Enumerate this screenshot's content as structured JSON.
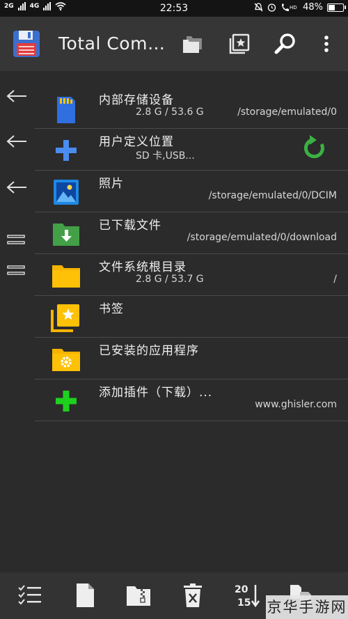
{
  "status_bar": {
    "time": "22:53",
    "left_labels": [
      "2G",
      "4G"
    ],
    "hd_label": "HD",
    "battery": "48%",
    "battery_level": 0.48
  },
  "app_bar": {
    "title": "Total Com…",
    "actions": [
      "folders-icon",
      "bookmark-star-icon",
      "search-icon",
      "more-vertical-icon"
    ]
  },
  "side_rail": {
    "buttons": [
      "arrow-left-icon",
      "arrow-left-icon",
      "arrow-left-icon",
      "equals-icon",
      "equals-icon"
    ]
  },
  "items": [
    {
      "name": "内部存储设备",
      "size": "2.8 G / 53.6 G",
      "path": "/storage/emulated/0"
    },
    {
      "name": "用户定义位置",
      "size": "SD 卡,USB...",
      "path": ""
    },
    {
      "name": "照片",
      "size": "",
      "path": "/storage/emulated/0/DCIM"
    },
    {
      "name": "已下载文件",
      "size": "",
      "path": "/storage/emulated/0/download"
    },
    {
      "name": "文件系统根目录",
      "size": "2.8 G / 53.7 G",
      "path": "/"
    },
    {
      "name": "书签",
      "size": "",
      "path": ""
    },
    {
      "name": "已安装的应用程序",
      "size": "",
      "path": ""
    },
    {
      "name": "添加插件（下载）...",
      "size": "",
      "path": "www.ghisler.com"
    }
  ],
  "bottom_bar": {
    "sort_top": "20",
    "sort_bottom": "15"
  },
  "watermark": "京华手游网",
  "colors": {
    "background": "#2b2b2b",
    "app_bar": "#363636",
    "folder_yellow": "#f5b400",
    "accent_green": "#4caf50",
    "accent_blue": "#3a7bd5"
  }
}
